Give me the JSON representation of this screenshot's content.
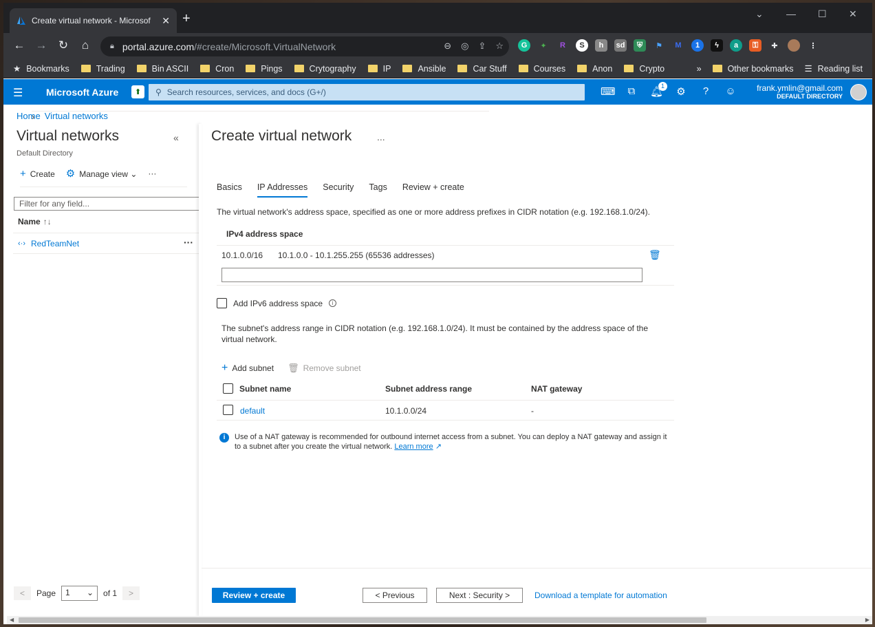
{
  "browser": {
    "tab_title": "Create virtual network - Microsof",
    "url_host": "portal.azure.com",
    "url_path": "/#create/Microsoft.VirtualNetwork",
    "bookmarks": [
      "Bookmarks",
      "Trading",
      "Bin ASCII",
      "Cron",
      "Pings",
      "Crytography",
      "IP",
      "Ansible",
      "Car Stuff",
      "Courses",
      "Anon",
      "Crypto"
    ],
    "overflow": "»",
    "other_bookmarks": "Other bookmarks",
    "reading_list": "Reading list"
  },
  "azure_header": {
    "brand": "Microsoft Azure",
    "search_placeholder": "Search resources, services, and docs (G+/)",
    "notification_count": "1",
    "user_email": "frank.ymlin@gmail.com",
    "user_directory": "DEFAULT DIRECTORY"
  },
  "breadcrumb": [
    "Home",
    "Virtual networks"
  ],
  "left_pane": {
    "title": "Virtual networks",
    "subtitle": "Default Directory",
    "create_label": "Create",
    "manage_view_label": "Manage view",
    "filter_placeholder": "Filter for any field...",
    "column_name": "Name",
    "rows": [
      {
        "name": "RedTeamNet"
      }
    ],
    "pager": {
      "label": "Page",
      "current": "1",
      "of_label": "of 1",
      "prev": "<",
      "next": ">"
    }
  },
  "main": {
    "title": "Create virtual network",
    "more": "...",
    "tabs": [
      {
        "label": "Basics",
        "active": false
      },
      {
        "label": "IP Addresses",
        "active": true
      },
      {
        "label": "Security",
        "active": false
      },
      {
        "label": "Tags",
        "active": false
      },
      {
        "label": "Review + create",
        "active": false
      }
    ],
    "address_space_desc": "The virtual network's address space, specified as one or more address prefixes in CIDR notation (e.g. 192.168.1.0/24).",
    "ipv4_header": "IPv4 address space",
    "address_space": {
      "cidr": "10.1.0.0/16",
      "range": "10.1.0.0 - 10.1.255.255 (65536 addresses)"
    },
    "new_address_value": "",
    "ipv6_label": "Add IPv6 address space",
    "subnet_desc": "The subnet's address range in CIDR notation (e.g. 192.168.1.0/24). It must be contained by the address space of the virtual network.",
    "add_subnet_label": "Add subnet",
    "remove_subnet_label": "Remove subnet",
    "subnet_columns": [
      "Subnet name",
      "Subnet address range",
      "NAT gateway"
    ],
    "subnets": [
      {
        "name": "default",
        "range": "10.1.0.0/24",
        "nat": "-"
      }
    ],
    "nat_info": "Use of a NAT gateway is recommended for outbound internet access from a subnet. You can deploy a NAT gateway and assign it to a subnet after you create the virtual network.",
    "learn_more": "Learn more"
  },
  "footer": {
    "review_create": "Review + create",
    "previous": "< Previous",
    "next": "Next : Security >",
    "template_link": "Download a template for automation"
  },
  "colors": {
    "azure_blue": "#0078d4",
    "chrome_dark": "#35363a",
    "search_bg": "#c7e0f4"
  }
}
